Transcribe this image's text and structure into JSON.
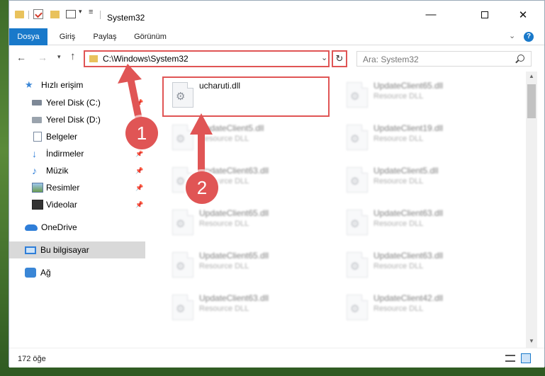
{
  "window": {
    "title": "System32"
  },
  "ribbon": {
    "tabs": [
      {
        "label": "Dosya",
        "active": true
      },
      {
        "label": "Giriş"
      },
      {
        "label": "Paylaş"
      },
      {
        "label": "Görünüm"
      }
    ],
    "help": "?"
  },
  "nav": {
    "address": "C:\\Windows\\System32",
    "search_placeholder": "Ara: System32"
  },
  "sidebar": {
    "items": [
      {
        "label": "Hızlı erişim",
        "icon": "star-icon"
      },
      {
        "label": "Yerel Disk (C:)",
        "icon": "disk-icon"
      },
      {
        "label": "Yerel Disk (D:)",
        "icon": "disk-icon"
      },
      {
        "label": "Belgeler",
        "icon": "documents-icon"
      },
      {
        "label": "İndirmeler",
        "icon": "download-icon"
      },
      {
        "label": "Müzik",
        "icon": "music-icon"
      },
      {
        "label": "Resimler",
        "icon": "pictures-icon"
      },
      {
        "label": "Videolar",
        "icon": "video-icon"
      },
      {
        "label": "OneDrive",
        "icon": "cloud-icon"
      },
      {
        "label": "Bu bilgisayar",
        "icon": "computer-icon",
        "selected": true
      },
      {
        "label": "Ağ",
        "icon": "network-icon"
      }
    ]
  },
  "files": [
    {
      "name": "ucharuti.dll",
      "type": ""
    },
    {
      "name": "UpdateClient65.dll",
      "type": "Resource DLL"
    },
    {
      "name": "UpdateClient5.dll",
      "type": "Resource DLL"
    },
    {
      "name": "UpdateClient19.dll",
      "type": "Resource DLL"
    },
    {
      "name": "UpdateClient63.dll",
      "type": "Resource DLL"
    },
    {
      "name": "UpdateClient5.dll",
      "type": "Resource DLL"
    },
    {
      "name": "UpdateClient65.dll",
      "type": "Resource DLL"
    },
    {
      "name": "UpdateClient63.dll",
      "type": "Resource DLL"
    },
    {
      "name": "UpdateClient65.dll",
      "type": "Resource DLL"
    },
    {
      "name": "UpdateClient63.dll",
      "type": "Resource DLL"
    },
    {
      "name": "UpdateClient63.dll",
      "type": "Resource DLL"
    },
    {
      "name": "UpdateClient42.dll",
      "type": "Resource DLL"
    }
  ],
  "status": {
    "count": "172 öğe"
  },
  "annotations": {
    "step1": "1",
    "step2": "2"
  },
  "colors": {
    "accent": "#1979ca",
    "highlight": "#e05555"
  }
}
